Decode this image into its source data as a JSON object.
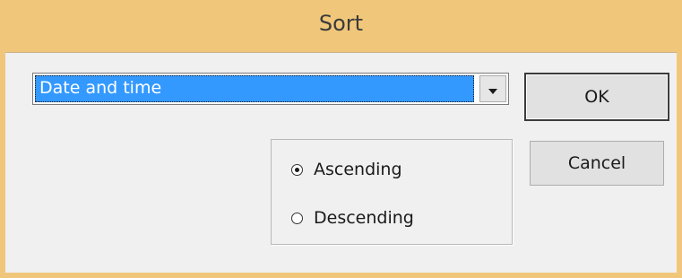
{
  "window": {
    "title": "Sort",
    "titlebar_color": "#f0c77a"
  },
  "sort_field": {
    "selected_value": "Date and time",
    "highlight_color": "#3399ff"
  },
  "order": {
    "ascending_label": "Ascending",
    "descending_label": "Descending",
    "selected": "Ascending"
  },
  "buttons": {
    "ok_label": "OK",
    "cancel_label": "Cancel"
  },
  "icons": {
    "dropdown": "chevron-down-icon",
    "radio_checked": "radio-checked-icon",
    "radio_unchecked": "radio-unchecked-icon"
  }
}
